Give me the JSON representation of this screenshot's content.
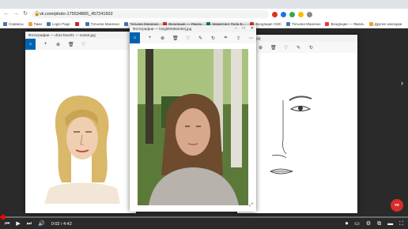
{
  "browser": {
    "url": "vk.com/photo-175534865_457241602",
    "bookmarks": [
      "Сервисы",
      "Паки",
      "Login Page",
      "",
      "Татьяна Маненко",
      "Татьяна Маненко",
      "Входящие — Ямаль",
      "Маркетинг Пола Б...",
      "",
      "Входящие СМС",
      "",
      "Татьяна Маненко",
      "Входящие — Ямаль",
      "Другие закладки"
    ]
  },
  "windows": {
    "left_title": "Фотографии — dra1-face01 — копия.jpg",
    "mid_title": "Фотографии — kGg5l05IBxkI92j.jpg",
    "right_title": "— копия.jpg"
  },
  "player": {
    "time_current": "0:02",
    "time_total": "4:42",
    "progress": 0.007,
    "badge": "VK"
  },
  "colors": {
    "accent": "#0063b1",
    "progress": "#ff0000"
  }
}
